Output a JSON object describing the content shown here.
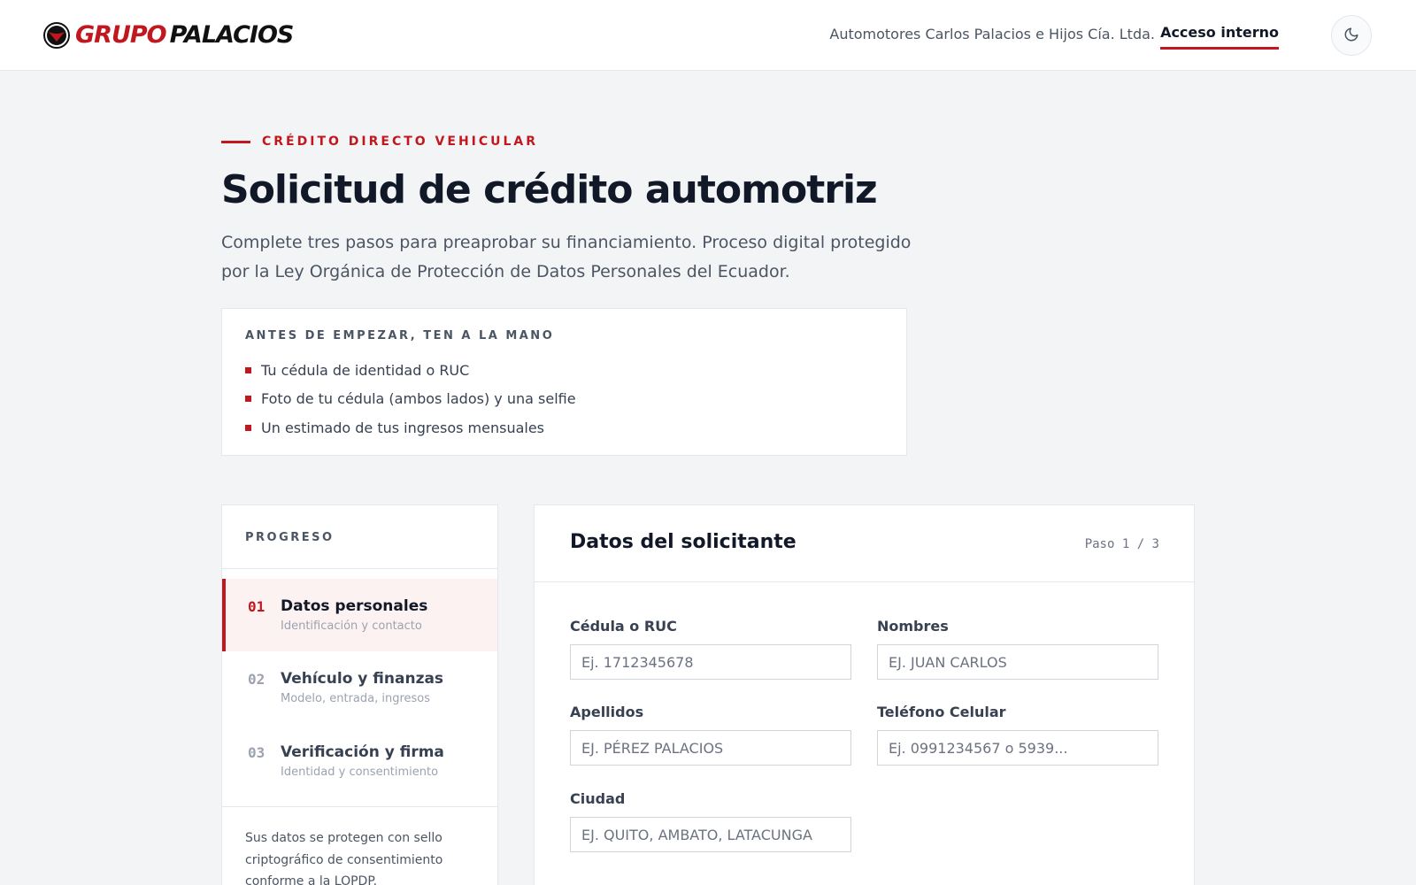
{
  "header": {
    "brand_part1": "GRUPO",
    "brand_part2": "PALACIOS",
    "company": "Automotores Carlos Palacios e Hijos Cía. Ltda.",
    "access_link": "Acceso interno"
  },
  "hero": {
    "eyebrow": "CRÉDITO DIRECTO VEHICULAR",
    "title": "Solicitud de crédito automotriz",
    "intro": "Complete tres pasos para preaprobar su financiamiento. Proceso digital protegido por la Ley Orgánica de Protección de Datos Personales del Ecuador."
  },
  "prep": {
    "title": "ANTES DE EMPEZAR, TEN A LA MANO",
    "items": [
      "Tu cédula de identidad o RUC",
      "Foto de tu cédula (ambos lados) y una selfie",
      "Un estimado de tus ingresos mensuales"
    ]
  },
  "progress": {
    "title": "PROGRESO",
    "steps": [
      {
        "num": "01",
        "title": "Datos personales",
        "subtitle": "Identificación y contacto"
      },
      {
        "num": "02",
        "title": "Vehículo y finanzas",
        "subtitle": "Modelo, entrada, ingresos"
      },
      {
        "num": "03",
        "title": "Verificación y firma",
        "subtitle": "Identidad y consentimiento"
      }
    ],
    "active_step": 1,
    "note": "Sus datos se protegen con sello criptográfico de consentimiento conforme a la LOPDP."
  },
  "form": {
    "title": "Datos del solicitante",
    "step_indicator": "Paso 1 / 3",
    "fields": {
      "cedula": {
        "label": "Cédula o RUC",
        "placeholder": "Ej. 1712345678",
        "value": ""
      },
      "nombres": {
        "label": "Nombres",
        "placeholder": "EJ. JUAN CARLOS",
        "value": ""
      },
      "apellidos": {
        "label": "Apellidos",
        "placeholder": "EJ. PÉREZ PALACIOS",
        "value": ""
      },
      "telefono": {
        "label": "Teléfono Celular",
        "placeholder": "Ej. 0991234567 o 5939...",
        "value": ""
      },
      "ciudad": {
        "label": "Ciudad",
        "placeholder": "EJ. QUITO, AMBATO, LATACUNGA",
        "value": ""
      }
    }
  },
  "icons": {
    "brand": "logo-emblem-icon",
    "theme": "moon-icon",
    "bullet": "square-bullet-icon"
  },
  "colors": {
    "accent": "#c0181e",
    "text": "#111827",
    "muted": "#4b5563",
    "background": "#f3f4f6",
    "active_step_bg": "#fdf2f2"
  }
}
